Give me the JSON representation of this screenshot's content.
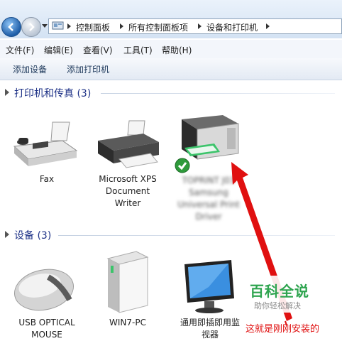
{
  "breadcrumbs": [
    "控制面板",
    "所有控制面板项",
    "设备和打印机"
  ],
  "menu": [
    "文件(F)",
    "编辑(E)",
    "查看(V)",
    "工具(T)",
    "帮助(H)"
  ],
  "commands": [
    "添加设备",
    "添加打印机"
  ],
  "printers_group": {
    "title": "打印机和传真 (3)",
    "items": [
      {
        "lines": [
          "Fax"
        ],
        "icon": "fax-icon"
      },
      {
        "lines": [
          "Microsoft XPS",
          "Document",
          "Writer"
        ],
        "icon": "printer-icon"
      },
      {
        "lines": [
          "TOPRINT J03",
          "Samsung",
          "Universal Print",
          "Driver"
        ],
        "icon": "multifunction-printer-icon",
        "blurred": true,
        "default": true
      }
    ]
  },
  "devices_group": {
    "title": "设备 (3)",
    "items": [
      {
        "lines": [
          "USB OPTICAL",
          "MOUSE"
        ],
        "icon": "mouse-icon"
      },
      {
        "lines": [
          "WIN7-PC"
        ],
        "icon": "computer-tower-icon"
      },
      {
        "lines": [
          "通用即插即用监",
          "视器"
        ],
        "icon": "monitor-icon"
      }
    ]
  },
  "watermark": {
    "title": "百科全说",
    "subtitle": "助你轻松解决"
  },
  "annotation": "这就是刚刚安装的",
  "colors": {
    "arrow": "#e01010",
    "group_title": "#1e3287",
    "watermark_green": "#2ea44f"
  }
}
